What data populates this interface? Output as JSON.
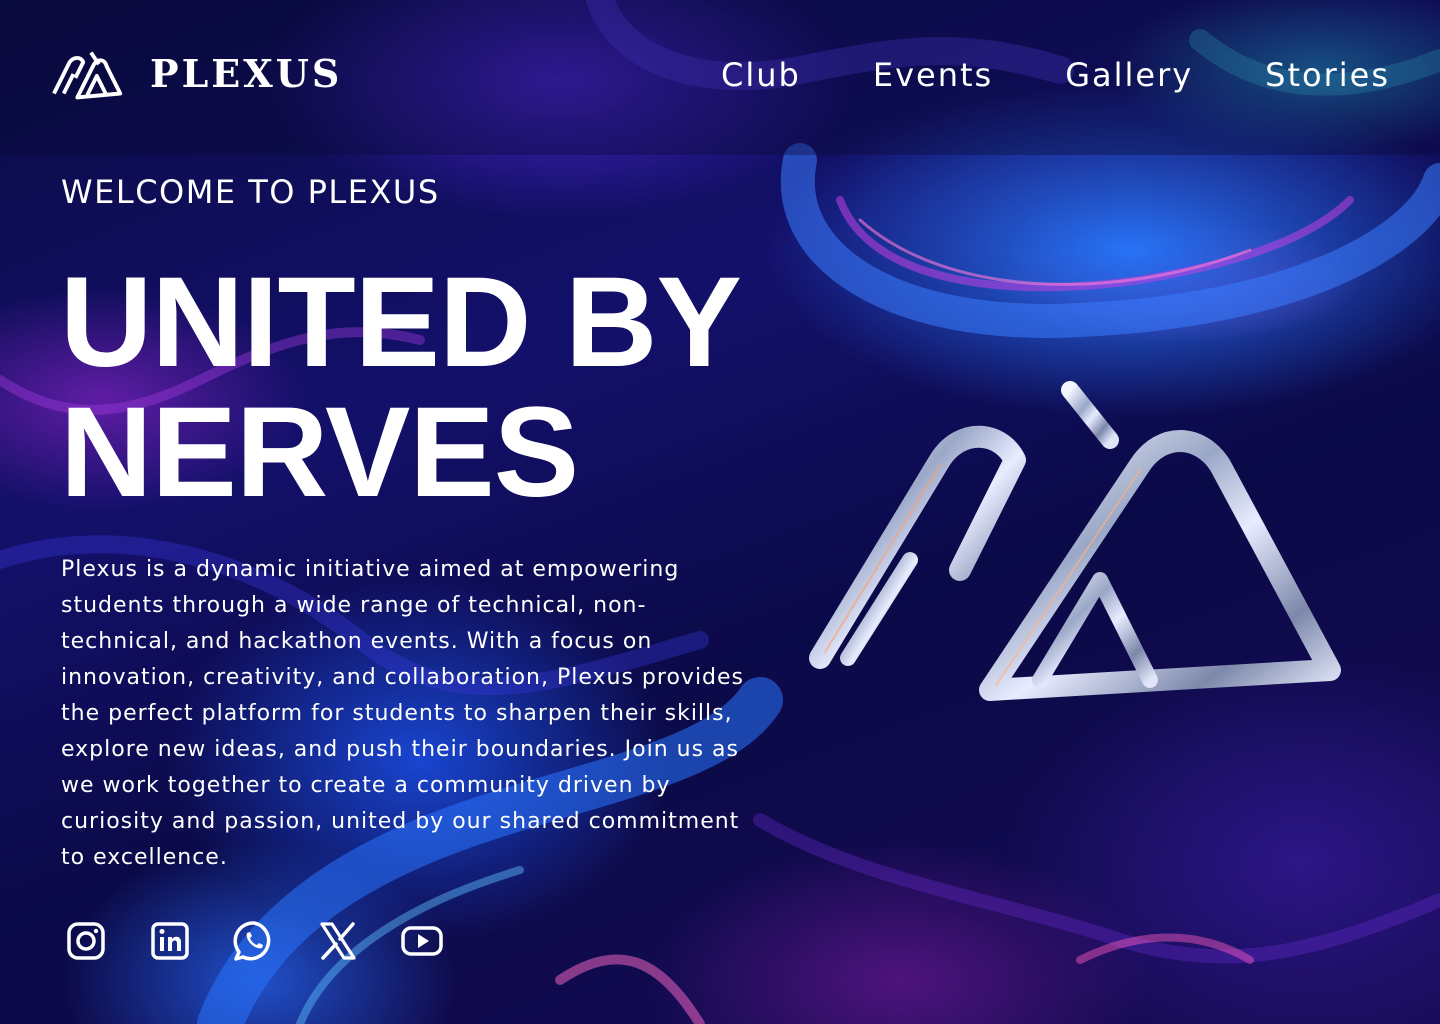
{
  "header": {
    "brand": "PLEXUS",
    "nav": [
      "Club",
      "Events",
      "Gallery",
      "Stories"
    ]
  },
  "hero": {
    "eyebrow": "WELCOME TO PLEXUS",
    "headline_line1": "UNITED BY",
    "headline_line2": "NERVES",
    "description": "Plexus is a dynamic initiative aimed at empowering students through a wide range of technical, non-technical, and hackathon events. With a focus on innovation, creativity, and collaboration, Plexus provides the perfect platform for students to sharpen their skills, explore new ideas, and push their boundaries. Join us as we work together to create a community driven by curiosity and passion, united by our shared commitment to excellence."
  },
  "socials": [
    "instagram-icon",
    "linkedin-icon",
    "whatsapp-icon",
    "x-icon",
    "youtube-icon"
  ],
  "colors": {
    "background": "#090a3a",
    "accent_blue": "#2f6bff",
    "accent_pink": "#e046d8",
    "text": "#ffffff"
  }
}
